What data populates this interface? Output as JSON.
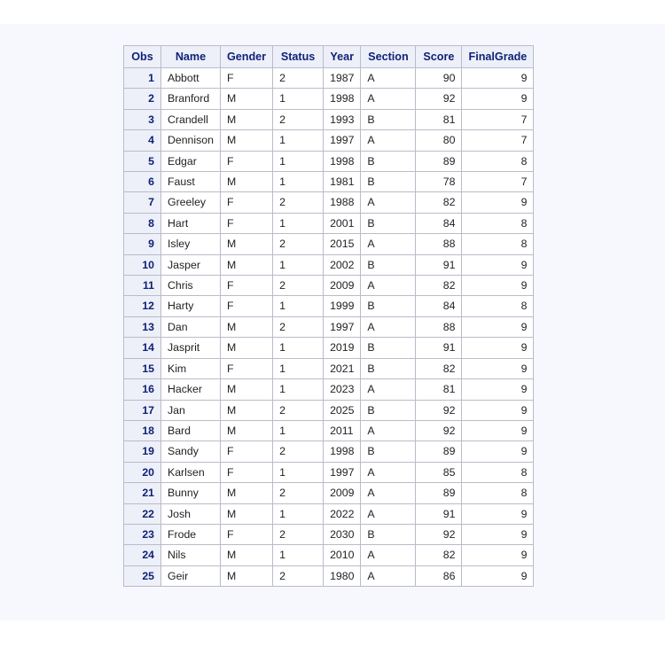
{
  "page": {
    "background_color": "#ffffff",
    "canvas_color": "#f7f8fd"
  },
  "table": {
    "name": "sas-output-table",
    "header_background": "#edf0f8",
    "header_text_color": "#112277",
    "body_text_color": "#222222",
    "border_color": "#b9bcc9",
    "columns": [
      {
        "key": "obs",
        "label": "Obs",
        "align": "right"
      },
      {
        "key": "name",
        "label": "Name",
        "align": "left"
      },
      {
        "key": "gender",
        "label": "Gender",
        "align": "left"
      },
      {
        "key": "status",
        "label": "Status",
        "align": "left"
      },
      {
        "key": "year",
        "label": "Year",
        "align": "left"
      },
      {
        "key": "section",
        "label": "Section",
        "align": "left"
      },
      {
        "key": "score",
        "label": "Score",
        "align": "right"
      },
      {
        "key": "finalgrade",
        "label": "FinalGrade",
        "align": "right"
      }
    ],
    "rows": [
      {
        "obs": "1",
        "name": "Abbott",
        "gender": "F",
        "status": "2",
        "year": "1987",
        "section": "A",
        "score": "90",
        "finalgrade": "9"
      },
      {
        "obs": "2",
        "name": "Branford",
        "gender": "M",
        "status": "1",
        "year": "1998",
        "section": "A",
        "score": "92",
        "finalgrade": "9"
      },
      {
        "obs": "3",
        "name": "Crandell",
        "gender": "M",
        "status": "2",
        "year": "1993",
        "section": "B",
        "score": "81",
        "finalgrade": "7"
      },
      {
        "obs": "4",
        "name": "Dennison",
        "gender": "M",
        "status": "1",
        "year": "1997",
        "section": "A",
        "score": "80",
        "finalgrade": "7"
      },
      {
        "obs": "5",
        "name": "Edgar",
        "gender": "F",
        "status": "1",
        "year": "1998",
        "section": "B",
        "score": "89",
        "finalgrade": "8"
      },
      {
        "obs": "6",
        "name": "Faust",
        "gender": "M",
        "status": "1",
        "year": "1981",
        "section": "B",
        "score": "78",
        "finalgrade": "7"
      },
      {
        "obs": "7",
        "name": "Greeley",
        "gender": "F",
        "status": "2",
        "year": "1988",
        "section": "A",
        "score": "82",
        "finalgrade": "9"
      },
      {
        "obs": "8",
        "name": "Hart",
        "gender": "F",
        "status": "1",
        "year": "2001",
        "section": "B",
        "score": "84",
        "finalgrade": "8"
      },
      {
        "obs": "9",
        "name": "Isley",
        "gender": "M",
        "status": "2",
        "year": "2015",
        "section": "A",
        "score": "88",
        "finalgrade": "8"
      },
      {
        "obs": "10",
        "name": "Jasper",
        "gender": "M",
        "status": "1",
        "year": "2002",
        "section": "B",
        "score": "91",
        "finalgrade": "9"
      },
      {
        "obs": "11",
        "name": "Chris",
        "gender": "F",
        "status": "2",
        "year": "2009",
        "section": "A",
        "score": "82",
        "finalgrade": "9"
      },
      {
        "obs": "12",
        "name": "Harty",
        "gender": "F",
        "status": "1",
        "year": "1999",
        "section": "B",
        "score": "84",
        "finalgrade": "8"
      },
      {
        "obs": "13",
        "name": "Dan",
        "gender": "M",
        "status": "2",
        "year": "1997",
        "section": "A",
        "score": "88",
        "finalgrade": "9"
      },
      {
        "obs": "14",
        "name": "Jasprit",
        "gender": "M",
        "status": "1",
        "year": "2019",
        "section": "B",
        "score": "91",
        "finalgrade": "9"
      },
      {
        "obs": "15",
        "name": "Kim",
        "gender": "F",
        "status": "1",
        "year": "2021",
        "section": "B",
        "score": "82",
        "finalgrade": "9"
      },
      {
        "obs": "16",
        "name": "Hacker",
        "gender": "M",
        "status": "1",
        "year": "2023",
        "section": "A",
        "score": "81",
        "finalgrade": "9"
      },
      {
        "obs": "17",
        "name": "Jan",
        "gender": "M",
        "status": "2",
        "year": "2025",
        "section": "B",
        "score": "92",
        "finalgrade": "9"
      },
      {
        "obs": "18",
        "name": "Bard",
        "gender": "M",
        "status": "1",
        "year": "2011",
        "section": "A",
        "score": "92",
        "finalgrade": "9"
      },
      {
        "obs": "19",
        "name": "Sandy",
        "gender": "F",
        "status": "2",
        "year": "1998",
        "section": "B",
        "score": "89",
        "finalgrade": "9"
      },
      {
        "obs": "20",
        "name": "Karlsen",
        "gender": "F",
        "status": "1",
        "year": "1997",
        "section": "A",
        "score": "85",
        "finalgrade": "8"
      },
      {
        "obs": "21",
        "name": "Bunny",
        "gender": "M",
        "status": "2",
        "year": "2009",
        "section": "A",
        "score": "89",
        "finalgrade": "8"
      },
      {
        "obs": "22",
        "name": "Josh",
        "gender": "M",
        "status": "1",
        "year": "2022",
        "section": "A",
        "score": "91",
        "finalgrade": "9"
      },
      {
        "obs": "23",
        "name": "Frode",
        "gender": "F",
        "status": "2",
        "year": "2030",
        "section": "B",
        "score": "92",
        "finalgrade": "9"
      },
      {
        "obs": "24",
        "name": "Nils",
        "gender": "M",
        "status": "1",
        "year": "2010",
        "section": "A",
        "score": "82",
        "finalgrade": "9"
      },
      {
        "obs": "25",
        "name": "Geir",
        "gender": "M",
        "status": "2",
        "year": "1980",
        "section": "A",
        "score": "86",
        "finalgrade": "9"
      }
    ]
  }
}
